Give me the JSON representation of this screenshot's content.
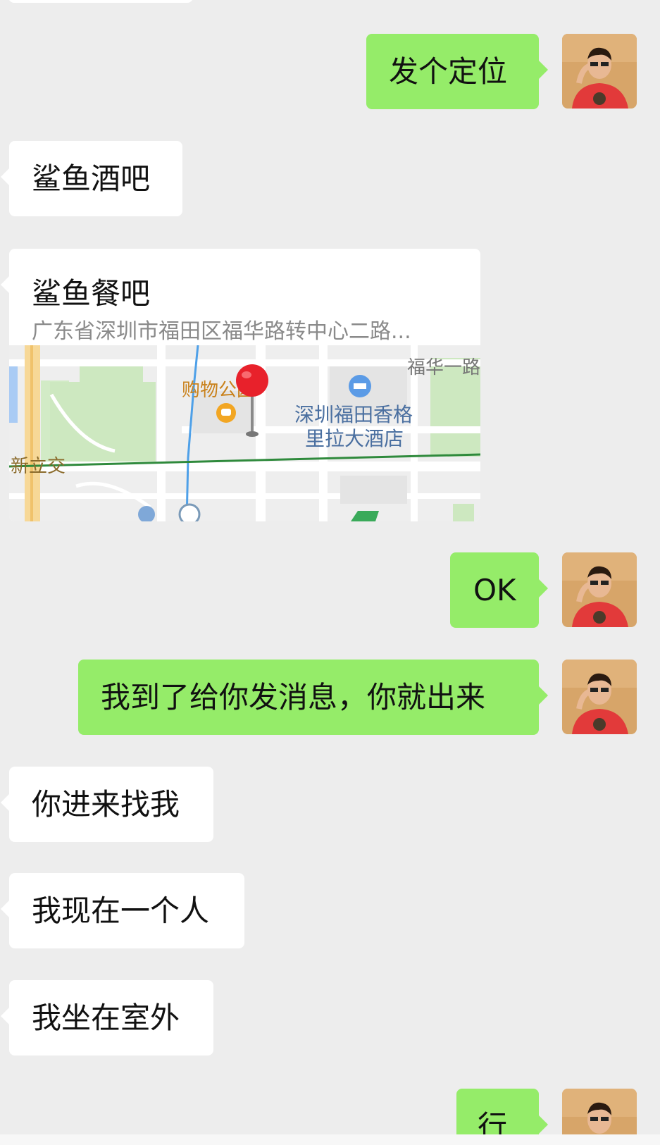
{
  "messages": {
    "m1": "发个定位",
    "m2": "鲨鱼酒吧",
    "m4": "OK",
    "m5": "我到了给你发消息，你就出来",
    "m6": "你进来找我",
    "m7": "我现在一个人",
    "m8": "我坐在室外",
    "m9": "行"
  },
  "location": {
    "name": "鲨鱼餐吧",
    "address": "广东省深圳市福田区福华路转中心二路...",
    "map_labels": {
      "road_top": "福华一路",
      "mall": "购物公园",
      "hotel_line1": "深圳福田香格",
      "hotel_line2": "里拉大酒店",
      "station": "新立交"
    }
  },
  "colors": {
    "background": "#ededed",
    "outgoing_bubble": "#95ec69",
    "incoming_bubble": "#ffffff",
    "pin": "#e8212b"
  }
}
